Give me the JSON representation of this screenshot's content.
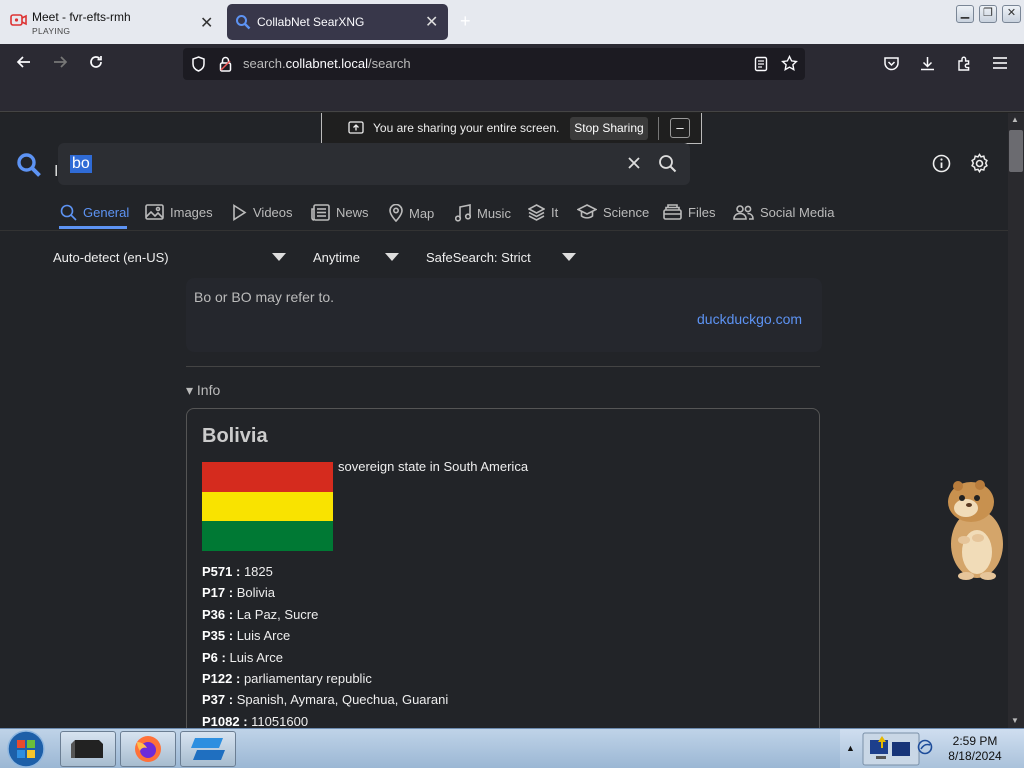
{
  "browser": {
    "tabs": [
      {
        "title": "Meet - fvr-efts-rmh",
        "subtitle": "PLAYING"
      },
      {
        "title": "CollabNet SearXNG"
      }
    ],
    "url_prefix": "search.",
    "url_domain": "collabnet.local",
    "url_path": "/search"
  },
  "share_bar": {
    "message": "You are sharing your entire screen.",
    "stop_label": "Stop Sharing",
    "minimize_label": "–"
  },
  "search": {
    "query": "bo"
  },
  "categories": [
    "General",
    "Images",
    "Videos",
    "News",
    "Map",
    "Music",
    "It",
    "Science",
    "Files",
    "Social Media"
  ],
  "filters": {
    "language": "Auto-detect (en-US)",
    "time": "Anytime",
    "safesearch": "SafeSearch: Strict"
  },
  "answer": {
    "text": "Bo or BO may refer to.",
    "source": "duckduckgo.com"
  },
  "info": {
    "toggle_label": "▾ Info",
    "name": "Bolivia",
    "description": "sovereign state in South America",
    "flag_colors": [
      "#d52b1e",
      "#f9e300",
      "#007934"
    ],
    "properties": [
      {
        "key": "P571 :",
        "value": "1825"
      },
      {
        "key": "P17 :",
        "value": "Bolivia"
      },
      {
        "key": "P36 :",
        "value": "La Paz, Sucre"
      },
      {
        "key": "P35 :",
        "value": "Luis Arce"
      },
      {
        "key": "P6 :",
        "value": "Luis Arce"
      },
      {
        "key": "P122 :",
        "value": "parliamentary republic"
      },
      {
        "key": "P37 :",
        "value": "Spanish, Aymara, Quechua, Guarani"
      },
      {
        "key": "P1082 :",
        "value": "11051600"
      }
    ]
  },
  "taskbar": {
    "time": "2:59 PM",
    "date": "8/18/2024"
  },
  "colors": {
    "accent": "#5d93f3",
    "page_bg": "#222428"
  }
}
